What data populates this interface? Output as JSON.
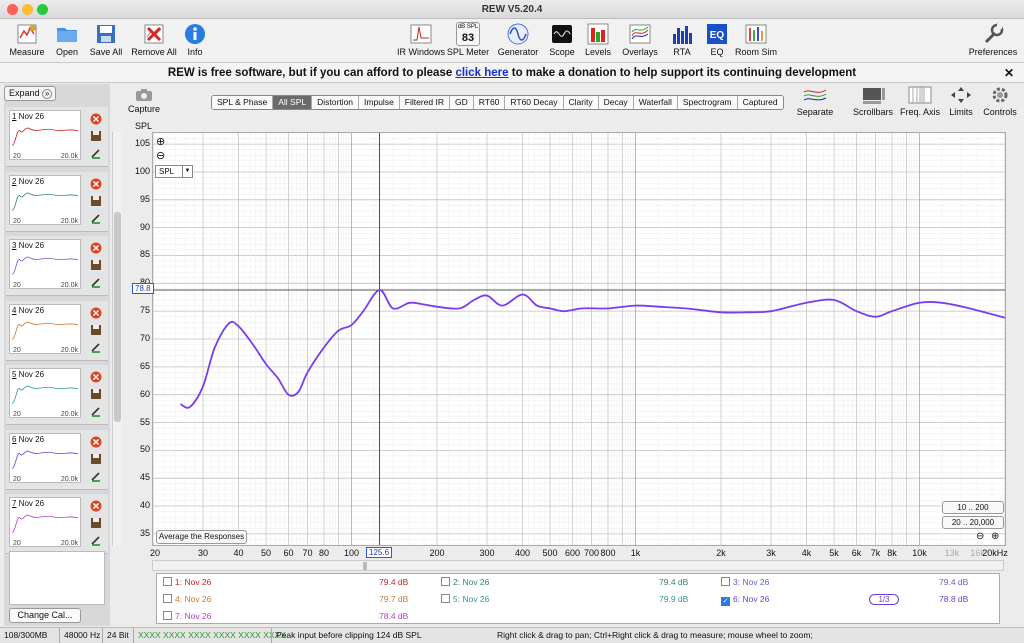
{
  "window": {
    "title": "REW V5.20.4"
  },
  "toolbar": {
    "left": [
      {
        "label": "Measure",
        "icon": "measure-icon"
      },
      {
        "label": "Open",
        "icon": "folder-icon"
      },
      {
        "label": "Save All",
        "icon": "save-icon"
      },
      {
        "label": "Remove All",
        "icon": "remove-all-icon"
      },
      {
        "label": "Info",
        "icon": "info-icon"
      }
    ],
    "center": [
      {
        "label": "IR Windows",
        "icon": "ir-windows-icon"
      },
      {
        "label": "SPL Meter",
        "icon": "spl-meter-icon",
        "reading_label": "dB SPL",
        "reading": "83"
      },
      {
        "label": "Generator",
        "icon": "generator-icon"
      },
      {
        "label": "Scope",
        "icon": "scope-icon"
      },
      {
        "label": "Levels",
        "icon": "levels-icon"
      },
      {
        "label": "Overlays",
        "icon": "overlays-icon"
      },
      {
        "label": "RTA",
        "icon": "rta-icon"
      },
      {
        "label": "EQ",
        "icon": "eq-icon"
      },
      {
        "label": "Room Sim",
        "icon": "room-sim-icon"
      }
    ],
    "right": [
      {
        "label": "Preferences",
        "icon": "wrench-icon"
      }
    ]
  },
  "donate": {
    "before": "REW is free software, but if you can afford to please",
    "link": "click here",
    "after": "to make a donation to help support its continuing development"
  },
  "sidebar": {
    "expand_label": "Expand",
    "expand_glyph": "»",
    "measurements": [
      {
        "num": "1",
        "name": "Nov 26",
        "color": "#cc2222"
      },
      {
        "num": "2",
        "name": "Nov 26",
        "color": "#2a8a6a"
      },
      {
        "num": "3",
        "name": "Nov 26",
        "color": "#6060d8"
      },
      {
        "num": "4",
        "name": "Nov 26",
        "color": "#cc7733"
      },
      {
        "num": "5",
        "name": "Nov 26",
        "color": "#2a9a9a"
      },
      {
        "num": "6",
        "name": "Nov 26",
        "color": "#6a3fd8"
      },
      {
        "num": "7",
        "name": "Nov 26",
        "color": "#b040c8"
      }
    ],
    "axis_min": "20",
    "axis_max": "20.0k",
    "change_cal_label": "Change Cal..."
  },
  "capture_label": "Capture",
  "tabs": [
    "SPL & Phase",
    "All SPL",
    "Distortion",
    "Impulse",
    "Filtered IR",
    "GD",
    "RT60",
    "RT60 Decay",
    "Clarity",
    "Decay",
    "Waterfall",
    "Spectrogram",
    "Captured"
  ],
  "active_tab": "All SPL",
  "right_tools": [
    {
      "label": "Separate",
      "icon": "separate-icon"
    },
    {
      "label": "Scrollbars",
      "icon": "scrollbars-icon"
    },
    {
      "label": "Freq. Axis",
      "icon": "freq-axis-icon"
    },
    {
      "label": "Limits",
      "icon": "limits-icon"
    },
    {
      "label": "Controls",
      "icon": "controls-icon"
    }
  ],
  "graph": {
    "y_axis_title": "SPL",
    "y_select": "SPL",
    "y_cursor": "78.8",
    "x_cursor": "125.6",
    "avg_button": "Average the Responses",
    "range_buttons": [
      "10 .. 200",
      "20 .. 20,000"
    ],
    "zoom_in": "+",
    "zoom_out": "−"
  },
  "chart_data": {
    "type": "line",
    "xlabel": "",
    "ylabel": "SPL",
    "x_scale": "log",
    "xlim": [
      20,
      20000
    ],
    "ylim": [
      33,
      107
    ],
    "x_ticks": [
      "20",
      "30",
      "40",
      "50",
      "60",
      "70",
      "80",
      "100",
      "125.6",
      "200",
      "300",
      "400",
      "500",
      "600",
      "700",
      "800",
      "1k",
      "2k",
      "3k",
      "4k",
      "5k",
      "6k",
      "7k",
      "8k",
      "10k",
      "13k",
      "16k",
      "20kHz"
    ],
    "y_ticks": [
      105,
      100,
      95,
      90,
      85,
      80,
      75,
      70,
      65,
      60,
      55,
      50,
      45,
      40,
      35
    ],
    "cursor": {
      "x": 125.6,
      "y": 78.8
    },
    "series": [
      {
        "name": "6: Nov 26",
        "color": "#7a3cf0",
        "x": [
          25,
          27,
          30,
          33,
          37,
          40,
          45,
          50,
          55,
          60,
          65,
          70,
          80,
          90,
          100,
          110,
          125.6,
          140,
          160,
          180,
          200,
          240,
          270,
          300,
          340,
          400,
          450,
          500,
          560,
          650,
          800,
          1000,
          1200,
          1500,
          2000,
          2500,
          3000,
          4000,
          5000,
          6000,
          7000,
          8000,
          10000,
          12000,
          15000,
          20000
        ],
        "y": [
          58.3,
          57.8,
          61.5,
          68.5,
          72.8,
          72.3,
          69,
          65.5,
          63,
          60,
          60.5,
          64,
          68.5,
          71.5,
          72.5,
          75,
          78.8,
          75.5,
          76.5,
          76.2,
          75.8,
          75.5,
          77,
          77.8,
          76,
          78,
          76,
          75.5,
          75,
          75.5,
          75.5,
          76,
          75.8,
          75.5,
          74.8,
          74.8,
          75,
          76.5,
          77,
          75,
          74,
          75,
          76.5,
          76.5,
          75.5,
          73.8
        ]
      }
    ]
  },
  "legend": {
    "rows": [
      [
        {
          "name": "1: Nov 26",
          "value": "79.4 dB",
          "color": "#cc2222",
          "checked": false
        },
        {
          "name": "2: Nov 26",
          "value": "79.4 dB",
          "color": "#2a8a6a",
          "checked": false
        },
        {
          "name": "3: Nov 26",
          "value": "79.4 dB",
          "color": "#6060d8",
          "checked": false
        }
      ],
      [
        {
          "name": "4: Nov 26",
          "value": "79.7 dB",
          "color": "#cc7733",
          "checked": false
        },
        {
          "name": "5: Nov 26",
          "value": "79.9 dB",
          "color": "#2a9a9a",
          "checked": false
        },
        {
          "name": "6: Nov 26",
          "value": "78.8 dB",
          "color": "#6a3fd8",
          "checked": true
        }
      ],
      [
        {
          "name": "7: Nov 26",
          "value": "78.4 dB",
          "color": "#b040c8",
          "checked": false
        }
      ]
    ],
    "smoothing": "1/3"
  },
  "status": {
    "memory": "108/300MB",
    "rate": "48000 Hz",
    "bits": "24 Bit",
    "inputs": "XXXX XXXX  XXXX XXXX  XXXX XXXX",
    "peak": "Peak input before clipping 124 dB SPL",
    "hint": "Right click & drag to pan; Ctrl+Right click & drag to measure; mouse wheel to zoom;"
  }
}
